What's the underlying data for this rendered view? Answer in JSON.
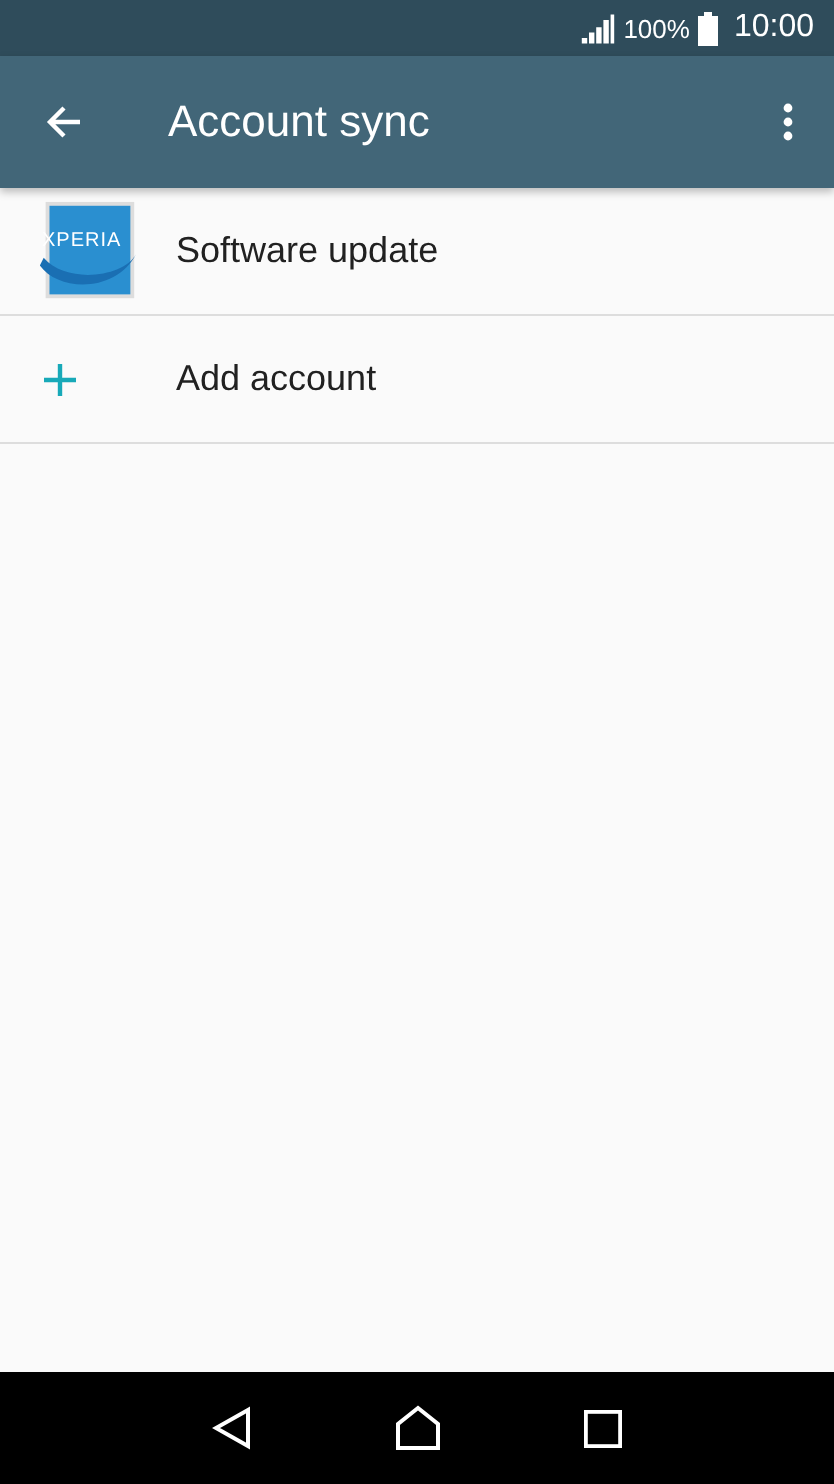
{
  "status_bar": {
    "battery": "100%",
    "time": "10:00"
  },
  "app_bar": {
    "title": "Account sync"
  },
  "items": [
    {
      "kind": "app",
      "label": "Software update",
      "logo_text": "XPERIA"
    },
    {
      "kind": "add",
      "label": "Add account"
    }
  ]
}
